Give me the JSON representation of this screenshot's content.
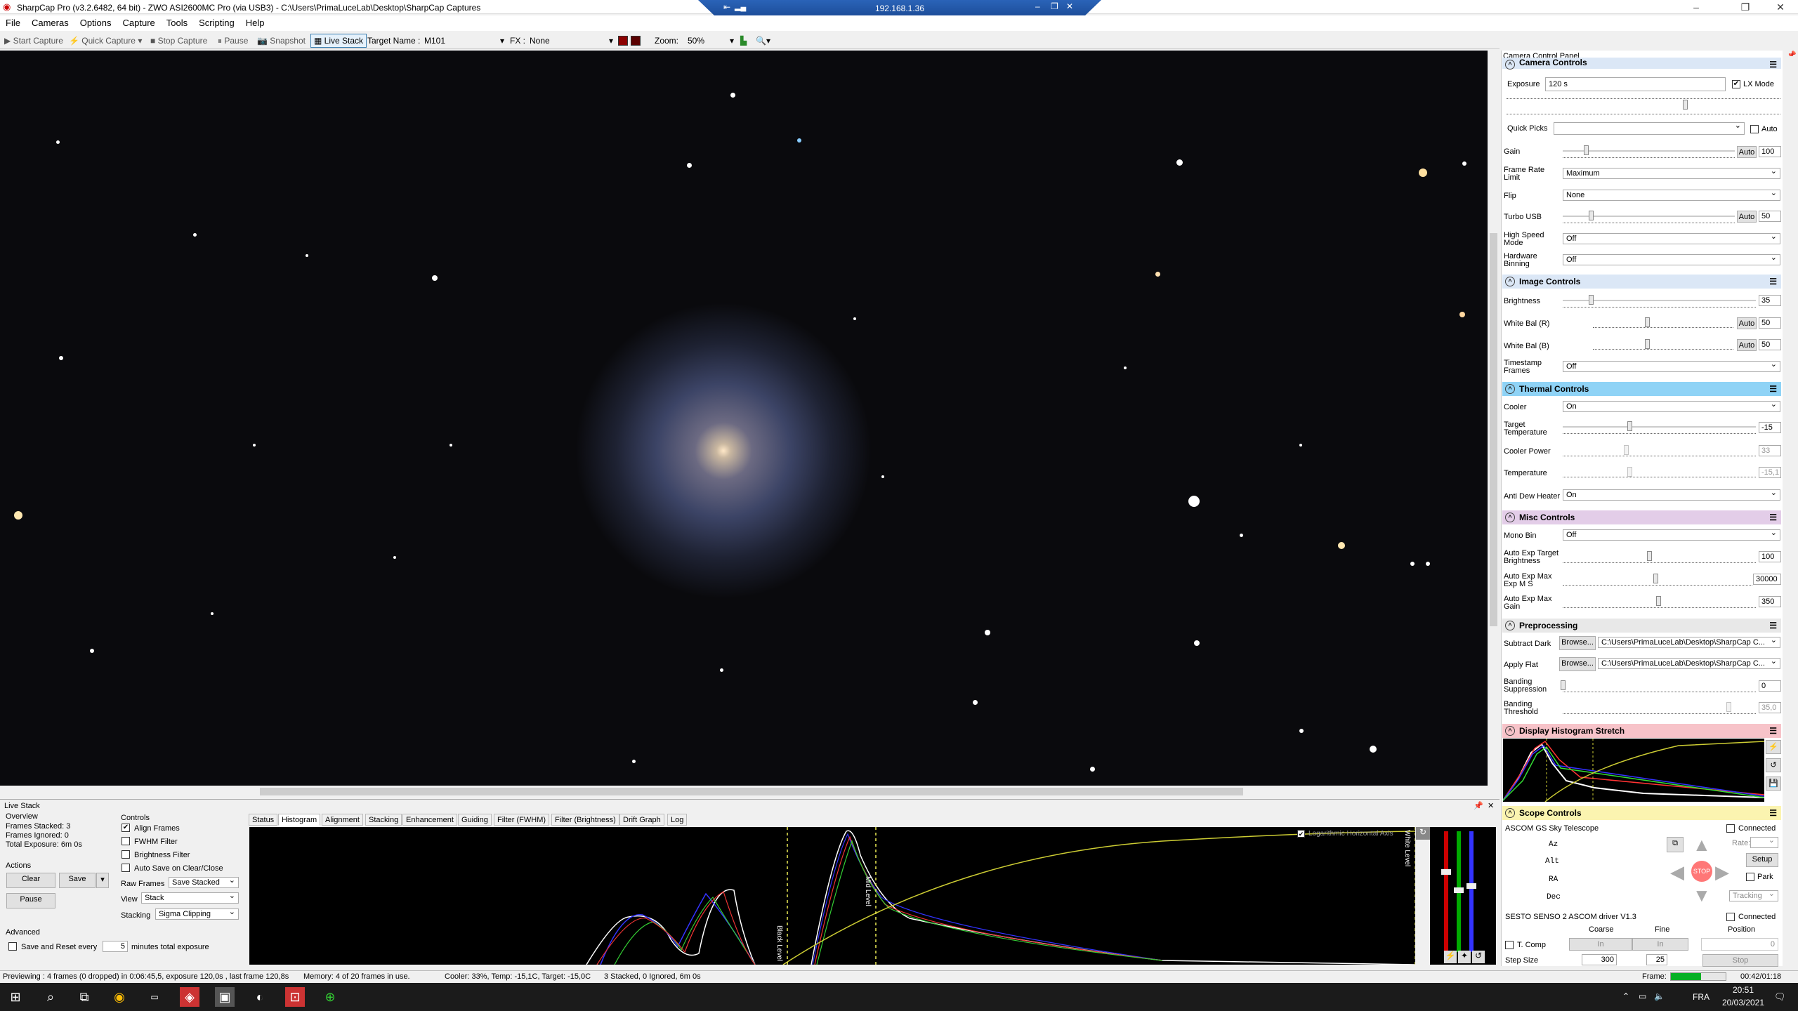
{
  "window": {
    "title": "SharpCap Pro (v3.2.6482, 64 bit) - ZWO ASI2600MC Pro (via USB3) - C:\\Users\\PrimaLuceLab\\Desktop\\SharpCap Captures",
    "remote_ip": "192.168.1.36"
  },
  "menu": [
    "File",
    "Cameras",
    "Options",
    "Capture",
    "Tools",
    "Scripting",
    "Help"
  ],
  "toolbar": {
    "start_capture": "Start Capture",
    "quick_capture": "Quick Capture",
    "stop_capture": "Stop Capture",
    "pause": "Pause",
    "snapshot": "Snapshot",
    "live_stack": "Live Stack",
    "target_label": "Target Name :",
    "target_value": "M101",
    "fx_label": "FX :",
    "fx_value": "None",
    "zoom_label": "Zoom:",
    "zoom_value": "50%"
  },
  "panel": {
    "title": "Camera Control Panel",
    "camera_controls": {
      "title": "Camera Controls",
      "exposure_label": "Exposure",
      "exposure_value": "120 s",
      "lx_mode": "LX Mode",
      "quick_picks": "Quick Picks",
      "auto": "Auto",
      "gain_label": "Gain",
      "gain_value": "100",
      "gain_level": 0.1,
      "frame_rate_label": "Frame Rate Limit",
      "frame_rate_value": "Maximum",
      "flip_label": "Flip",
      "flip_value": "None",
      "turbo_label": "Turbo USB",
      "turbo_value": "50",
      "turbo_level": 0.12,
      "hs_label": "High Speed Mode",
      "hs_value": "Off",
      "hb_label": "Hardware Binning",
      "hb_value": "Off"
    },
    "image_controls": {
      "title": "Image Controls",
      "brightness_label": "Brightness",
      "brightness_value": "35",
      "wbr_label": "White Bal (R)",
      "wbr_value": "50",
      "wbb_label": "White Bal (B)",
      "wbb_value": "50",
      "ts_label": "Timestamp Frames",
      "ts_value": "Off"
    },
    "thermal_controls": {
      "title": "Thermal Controls",
      "cooler_label": "Cooler",
      "cooler_value": "On",
      "target_label": "Target Temperature",
      "target_value": "-15",
      "power_label": "Cooler Power",
      "power_value": "33",
      "temp_label": "Temperature",
      "temp_value": "-15,1",
      "dew_label": "Anti Dew Heater",
      "dew_value": "On"
    },
    "misc_controls": {
      "title": "Misc Controls",
      "mono_label": "Mono Bin",
      "mono_value": "Off",
      "aet_label": "Auto Exp Target Brightness",
      "aet_value": "100",
      "aem_label": "Auto Exp Max Exp M S",
      "aem_value": "30000",
      "aeg_label": "Auto Exp Max Gain",
      "aeg_value": "350"
    },
    "preprocessing": {
      "title": "Preprocessing",
      "dark_label": "Subtract Dark",
      "flat_label": "Apply Flat",
      "browse": "Browse...",
      "dark_path": "C:\\Users\\PrimaLuceLab\\Desktop\\SharpCap C...",
      "flat_path": "C:\\Users\\PrimaLuceLab\\Desktop\\SharpCap C...",
      "bs_label": "Banding Suppression",
      "bs_value": "0",
      "bt_label": "Banding Threshold",
      "bt_value": "35,0"
    },
    "histogram": {
      "title": "Display Histogram Stretch"
    },
    "scope": {
      "title": "Scope Controls",
      "name": "ASCOM GS Sky Telescope",
      "connected": "Connected",
      "az": "Az",
      "alt": "Alt",
      "ra": "RA",
      "dec": "Dec",
      "rate": "Rate:",
      "setup": "Setup",
      "park": "Park",
      "tracking": "Tracking",
      "stop": "STOP",
      "focuser": "SESTO SENSO 2 ASCOM driver V1.3",
      "coarse": "Coarse",
      "fine": "Fine",
      "position": "Position",
      "tcomp": "T. Comp",
      "in": "In",
      "stop_btn": "Stop",
      "pos_value": "0",
      "step_label": "Step Size",
      "step_coarse": "300",
      "step_fine": "25"
    }
  },
  "live_stack": {
    "title": "Live Stack",
    "overview": "Overview",
    "frames_stacked": "Frames Stacked: 3",
    "frames_ignored": "Frames Ignored:  0",
    "total_exposure": "Total Exposure:  6m 0s",
    "actions": "Actions",
    "clear": "Clear",
    "save": "Save",
    "pause": "Pause",
    "advanced": "Advanced",
    "save_reset": "Save and Reset every",
    "minutes": "5",
    "minutes_label": "minutes total exposure",
    "controls": "Controls",
    "align": "Align Frames",
    "fwhm": "FWHM Filter",
    "bright": "Brightness Filter",
    "autosave": "Auto Save on Clear/Close",
    "raw_label": "Raw Frames",
    "raw_value": "Save Stacked",
    "view_label": "View",
    "view_value": "Stack",
    "stacking_label": "Stacking",
    "stacking_value": "Sigma Clipping",
    "tabs": [
      "Status",
      "Histogram",
      "Alignment",
      "Stacking",
      "Enhancement",
      "Guiding",
      "Filter (FWHM)",
      "Filter (Brightness)",
      "Drift Graph",
      "Log"
    ],
    "log_axis": "Logarithmic Horizontal Axis",
    "black_level": "Black Level",
    "mid_level": "Mid Level",
    "white_level": "White Level"
  },
  "status": {
    "preview": "Previewing : 4 frames (0 dropped) in 0:06:45,5, exposure 120,0s , last frame 120,8s",
    "memory": "Memory: 4 of 20 frames in use.",
    "cooler": "Cooler: 33%, Temp: -15,1C, Target: -15,0C",
    "stacked": "3 Stacked, 0 Ignored, 6m 0s",
    "frame_label": "Frame:",
    "frame_time": "00:42/01:18",
    "frame_progress": 0.55
  },
  "taskbar": {
    "lang": "FRA",
    "time": "20:51",
    "date": "20/03/2021"
  }
}
